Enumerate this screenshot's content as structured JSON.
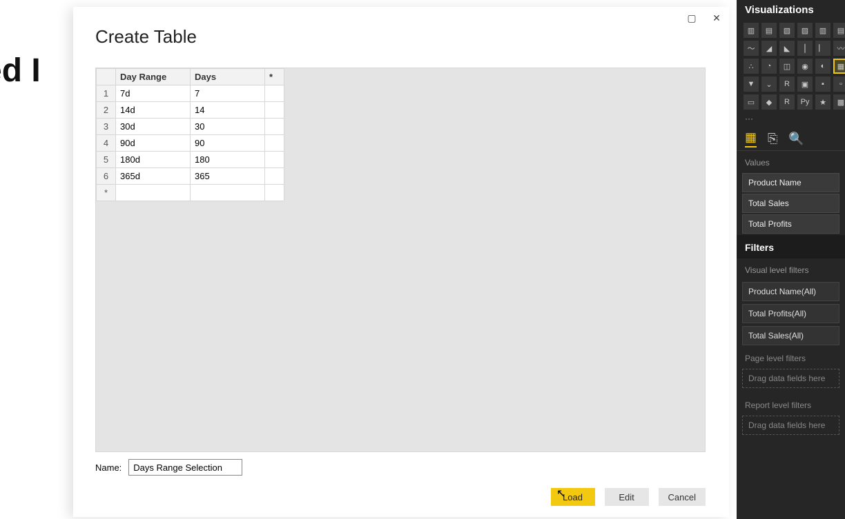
{
  "background": {
    "text": "aded I"
  },
  "dialog": {
    "title": "Create Table",
    "window_buttons": {
      "maximize": "▢",
      "close": "✕"
    },
    "grid": {
      "headers": {
        "col1": "Day Range",
        "col2": "Days",
        "star": "*"
      },
      "rows": [
        {
          "n": "1",
          "range": "7d",
          "days": "7"
        },
        {
          "n": "2",
          "range": "14d",
          "days": "14"
        },
        {
          "n": "3",
          "range": "30d",
          "days": "30"
        },
        {
          "n": "4",
          "range": "90d",
          "days": "90"
        },
        {
          "n": "5",
          "range": "180d",
          "days": "180"
        },
        {
          "n": "6",
          "range": "365d",
          "days": "365"
        }
      ],
      "new_row_marker": "*"
    },
    "name_label": "Name:",
    "name_value": "Days Range Selection",
    "buttons": {
      "load": "Load",
      "edit": "Edit",
      "cancel": "Cancel"
    }
  },
  "vis_panel": {
    "title": "Visualizations",
    "more": "···",
    "icons": [
      "bar-stacked",
      "bar-clustered",
      "column-stacked",
      "column-clustered",
      "bar-100",
      "column-100",
      "line",
      "area",
      "area-stacked",
      "line-bar",
      "line-column",
      "ribbon",
      "scatter",
      "pie",
      "treemap",
      "donut",
      "gauge",
      "table",
      "funnel",
      "waterfall",
      "r-script",
      "kpi",
      "matrix",
      "card",
      "slicer",
      "arcgis",
      "r-visual",
      "py-visual",
      "key-influencers",
      "more"
    ],
    "selected_icon_index": 17,
    "tabs": {
      "fields": "fields-tab",
      "format": "format-tab",
      "analytics": "analytics-tab"
    },
    "values_label": "Values",
    "values": [
      "Product Name",
      "Total Sales",
      "Total Profits"
    ],
    "filters_title": "Filters",
    "visual_filters_label": "Visual level filters",
    "visual_filters": [
      "Product Name(All)",
      "Total Profits(All)",
      "Total Sales(All)"
    ],
    "page_filters_label": "Page level filters",
    "drag_hint": "Drag data fields here",
    "report_filters_label": "Report level filters"
  }
}
